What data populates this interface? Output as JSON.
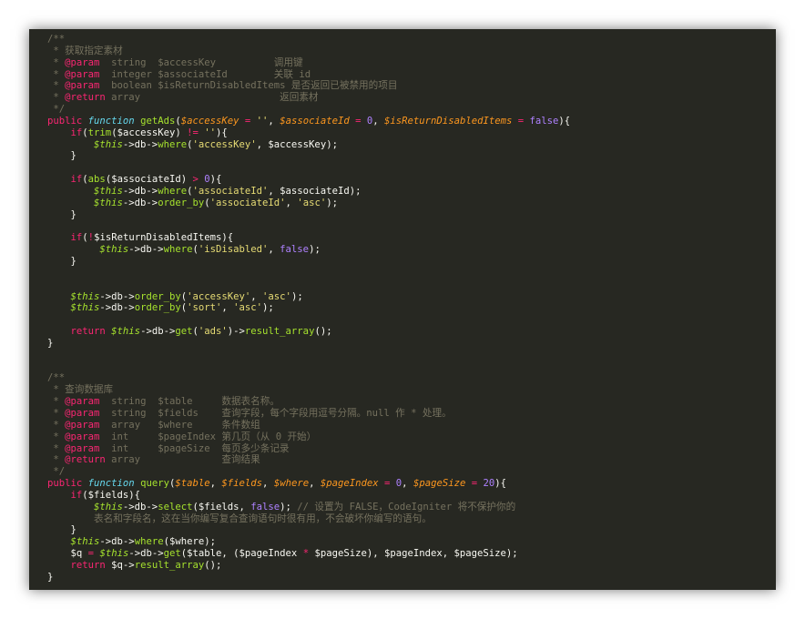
{
  "editor": {
    "theme_colors": {
      "background": "#272822",
      "comment": "#75715e",
      "keyword": "#f92672",
      "function": "#a6e22e",
      "variable": "#fd971f",
      "string": "#e6db74",
      "number": "#ae81ff",
      "storage": "#66d9ef",
      "text": "#f8f8f2"
    },
    "lines": [
      [
        [
          "com",
          "/**"
        ]
      ],
      [
        [
          "com",
          " * 获取指定素材"
        ]
      ],
      [
        [
          "com",
          " * "
        ],
        [
          "ann",
          "@param"
        ],
        [
          "com",
          "  string  $accessKey          调用键"
        ]
      ],
      [
        [
          "com",
          " * "
        ],
        [
          "ann",
          "@param"
        ],
        [
          "com",
          "  integer $associateId        关联 id"
        ]
      ],
      [
        [
          "com",
          " * "
        ],
        [
          "ann",
          "@param"
        ],
        [
          "com",
          "  boolean $isReturnDisabledItems 是否返回已被禁用的项目"
        ]
      ],
      [
        [
          "com",
          " * "
        ],
        [
          "ann",
          "@return"
        ],
        [
          "com",
          " array                        返回素材"
        ]
      ],
      [
        [
          "com",
          " */"
        ]
      ],
      [
        [
          "kw",
          "public "
        ],
        [
          "fnkw",
          "function "
        ],
        [
          "fn",
          "getAds"
        ],
        [
          "plain",
          "("
        ],
        [
          "var",
          "$accessKey"
        ],
        [
          "op",
          " = "
        ],
        [
          "str",
          "''"
        ],
        [
          "plain",
          ", "
        ],
        [
          "var",
          "$associateId"
        ],
        [
          "op",
          " = "
        ],
        [
          "num",
          "0"
        ],
        [
          "plain",
          ", "
        ],
        [
          "var",
          "$isReturnDisabledItems"
        ],
        [
          "op",
          " = "
        ],
        [
          "num",
          "false"
        ],
        [
          "plain",
          "){"
        ]
      ],
      [
        [
          "plain",
          "    "
        ],
        [
          "kw",
          "if"
        ],
        [
          "plain",
          "("
        ],
        [
          "fn",
          "trim"
        ],
        [
          "plain",
          "($accessKey) "
        ],
        [
          "op",
          "!="
        ],
        [
          "plain",
          " "
        ],
        [
          "str",
          "''"
        ],
        [
          "plain",
          "){"
        ]
      ],
      [
        [
          "plain",
          "        "
        ],
        [
          "this",
          "$this"
        ],
        [
          "plain",
          "->db->"
        ],
        [
          "fn",
          "where"
        ],
        [
          "plain",
          "("
        ],
        [
          "str",
          "'accessKey'"
        ],
        [
          "plain",
          ", $accessKey);"
        ]
      ],
      [
        [
          "plain",
          "    }"
        ]
      ],
      [
        [
          "plain",
          ""
        ]
      ],
      [
        [
          "plain",
          "    "
        ],
        [
          "kw",
          "if"
        ],
        [
          "plain",
          "("
        ],
        [
          "fn",
          "abs"
        ],
        [
          "plain",
          "($associateId) "
        ],
        [
          "op",
          ">"
        ],
        [
          "plain",
          " "
        ],
        [
          "num",
          "0"
        ],
        [
          "plain",
          "){"
        ]
      ],
      [
        [
          "plain",
          "        "
        ],
        [
          "this",
          "$this"
        ],
        [
          "plain",
          "->db->"
        ],
        [
          "fn",
          "where"
        ],
        [
          "plain",
          "("
        ],
        [
          "str",
          "'associateId'"
        ],
        [
          "plain",
          ", $associateId);"
        ]
      ],
      [
        [
          "plain",
          "        "
        ],
        [
          "this",
          "$this"
        ],
        [
          "plain",
          "->db->"
        ],
        [
          "fn",
          "order_by"
        ],
        [
          "plain",
          "("
        ],
        [
          "str",
          "'associateId'"
        ],
        [
          "plain",
          ", "
        ],
        [
          "str",
          "'asc'"
        ],
        [
          "plain",
          ");"
        ]
      ],
      [
        [
          "plain",
          "    }"
        ]
      ],
      [
        [
          "plain",
          ""
        ]
      ],
      [
        [
          "plain",
          "    "
        ],
        [
          "kw",
          "if"
        ],
        [
          "plain",
          "("
        ],
        [
          "op",
          "!"
        ],
        [
          "plain",
          "$isReturnDisabledItems){"
        ]
      ],
      [
        [
          "plain",
          "         "
        ],
        [
          "this",
          "$this"
        ],
        [
          "plain",
          "->db->"
        ],
        [
          "fn",
          "where"
        ],
        [
          "plain",
          "("
        ],
        [
          "str",
          "'isDisabled'"
        ],
        [
          "plain",
          ", "
        ],
        [
          "num",
          "false"
        ],
        [
          "plain",
          ");"
        ]
      ],
      [
        [
          "plain",
          "    }"
        ]
      ],
      [
        [
          "plain",
          ""
        ]
      ],
      [
        [
          "plain",
          ""
        ]
      ],
      [
        [
          "plain",
          "    "
        ],
        [
          "this",
          "$this"
        ],
        [
          "plain",
          "->db->"
        ],
        [
          "fn",
          "order_by"
        ],
        [
          "plain",
          "("
        ],
        [
          "str",
          "'accessKey'"
        ],
        [
          "plain",
          ", "
        ],
        [
          "str",
          "'asc'"
        ],
        [
          "plain",
          ");"
        ]
      ],
      [
        [
          "plain",
          "    "
        ],
        [
          "this",
          "$this"
        ],
        [
          "plain",
          "->db->"
        ],
        [
          "fn",
          "order_by"
        ],
        [
          "plain",
          "("
        ],
        [
          "str",
          "'sort'"
        ],
        [
          "plain",
          ", "
        ],
        [
          "str",
          "'asc'"
        ],
        [
          "plain",
          ");"
        ]
      ],
      [
        [
          "plain",
          ""
        ]
      ],
      [
        [
          "plain",
          "    "
        ],
        [
          "kw",
          "return "
        ],
        [
          "this",
          "$this"
        ],
        [
          "plain",
          "->db->"
        ],
        [
          "fn",
          "get"
        ],
        [
          "plain",
          "("
        ],
        [
          "str",
          "'ads'"
        ],
        [
          "plain",
          ")->"
        ],
        [
          "fn",
          "result_array"
        ],
        [
          "plain",
          "();"
        ]
      ],
      [
        [
          "plain",
          "}"
        ]
      ],
      [
        [
          "plain",
          ""
        ]
      ],
      [
        [
          "plain",
          ""
        ]
      ],
      [
        [
          "com",
          "/**"
        ]
      ],
      [
        [
          "com",
          " * 查询数据库"
        ]
      ],
      [
        [
          "com",
          " * "
        ],
        [
          "ann",
          "@param"
        ],
        [
          "com",
          "  string  $table     数据表名称。"
        ]
      ],
      [
        [
          "com",
          " * "
        ],
        [
          "ann",
          "@param"
        ],
        [
          "com",
          "  string  $fields    查询字段，每个字段用逗号分隔。null 作 * 处理。"
        ]
      ],
      [
        [
          "com",
          " * "
        ],
        [
          "ann",
          "@param"
        ],
        [
          "com",
          "  array   $where     条件数组"
        ]
      ],
      [
        [
          "com",
          " * "
        ],
        [
          "ann",
          "@param"
        ],
        [
          "com",
          "  int     $pageIndex 第几页（从 0 开始）"
        ]
      ],
      [
        [
          "com",
          " * "
        ],
        [
          "ann",
          "@param"
        ],
        [
          "com",
          "  int     $pageSize  每页多少条记录"
        ]
      ],
      [
        [
          "com",
          " * "
        ],
        [
          "ann",
          "@return"
        ],
        [
          "com",
          " array              查询结果"
        ]
      ],
      [
        [
          "com",
          " */"
        ]
      ],
      [
        [
          "kw",
          "public "
        ],
        [
          "fnkw",
          "function "
        ],
        [
          "fn",
          "query"
        ],
        [
          "plain",
          "("
        ],
        [
          "var",
          "$table"
        ],
        [
          "plain",
          ", "
        ],
        [
          "var",
          "$fields"
        ],
        [
          "plain",
          ", "
        ],
        [
          "var",
          "$where"
        ],
        [
          "plain",
          ", "
        ],
        [
          "var",
          "$pageIndex"
        ],
        [
          "op",
          " = "
        ],
        [
          "num",
          "0"
        ],
        [
          "plain",
          ", "
        ],
        [
          "var",
          "$pageSize"
        ],
        [
          "op",
          " = "
        ],
        [
          "num",
          "20"
        ],
        [
          "plain",
          "){"
        ]
      ],
      [
        [
          "plain",
          "    "
        ],
        [
          "kw",
          "if"
        ],
        [
          "plain",
          "($fields){"
        ]
      ],
      [
        [
          "plain",
          "        "
        ],
        [
          "this",
          "$this"
        ],
        [
          "plain",
          "->db->"
        ],
        [
          "fn",
          "select"
        ],
        [
          "plain",
          "($fields, "
        ],
        [
          "num",
          "false"
        ],
        [
          "plain",
          "); "
        ],
        [
          "com",
          "// 设置为 FALSE，CodeIgniter 将不保护你的"
        ]
      ],
      [
        [
          "plain",
          "        "
        ],
        [
          "com",
          "表名和字段名，这在当你编写复合查询语句时很有用，不会破坏你编写的语句。"
        ]
      ],
      [
        [
          "plain",
          "    }"
        ]
      ],
      [
        [
          "plain",
          "    "
        ],
        [
          "this",
          "$this"
        ],
        [
          "plain",
          "->db->"
        ],
        [
          "fn",
          "where"
        ],
        [
          "plain",
          "($where);"
        ]
      ],
      [
        [
          "plain",
          "    $q "
        ],
        [
          "op",
          "="
        ],
        [
          "plain",
          " "
        ],
        [
          "this",
          "$this"
        ],
        [
          "plain",
          "->db->"
        ],
        [
          "fn",
          "get"
        ],
        [
          "plain",
          "($table, ($pageIndex "
        ],
        [
          "op",
          "*"
        ],
        [
          "plain",
          " $pageSize), $pageIndex, $pageSize);"
        ]
      ],
      [
        [
          "plain",
          "    "
        ],
        [
          "kw",
          "return "
        ],
        [
          "plain",
          "$q->"
        ],
        [
          "fn",
          "result_array"
        ],
        [
          "plain",
          "();"
        ]
      ],
      [
        [
          "plain",
          "}"
        ]
      ]
    ]
  }
}
